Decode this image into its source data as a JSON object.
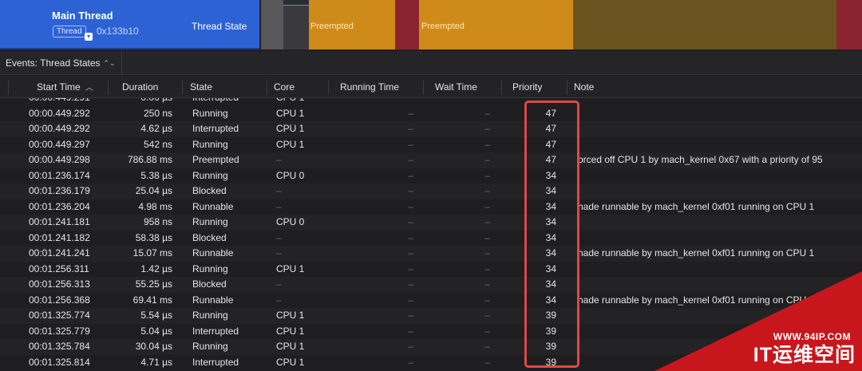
{
  "track": {
    "thread_name": "Main Thread",
    "thread_badge": "Thread",
    "thread_id": "0x133b10",
    "lane_label": "Thread State",
    "segments": [
      {
        "label": "Preempted"
      },
      {
        "label": "Preempted"
      }
    ]
  },
  "events_bar": {
    "selector_label": "Events: Thread States",
    "selector_icon": "chevron-up-down-icon"
  },
  "table": {
    "columns": {
      "start_time": "Start Time",
      "duration": "Duration",
      "state": "State",
      "core": "Core",
      "running_time": "Running Time",
      "wait_time": "Wait Time",
      "priority": "Priority",
      "note": "Note"
    },
    "sort_icon": "sort-ascending-icon",
    "clipped_top_row": {
      "start": "00:00.449.291",
      "duration": "0.00 µs",
      "state": "Interrupted",
      "core": "CPU 1"
    },
    "rows": [
      {
        "start": "00:00.449.292",
        "duration": "250 ns",
        "state": "Running",
        "core": "CPU 1",
        "running": "–",
        "wait": "–",
        "priority": "47",
        "note": ""
      },
      {
        "start": "00:00.449.292",
        "duration": "4.62 µs",
        "state": "Interrupted",
        "core": "CPU 1",
        "running": "–",
        "wait": "–",
        "priority": "47",
        "note": ""
      },
      {
        "start": "00:00.449.297",
        "duration": "542 ns",
        "state": "Running",
        "core": "CPU 1",
        "running": "–",
        "wait": "–",
        "priority": "47",
        "note": ""
      },
      {
        "start": "00:00.449.298",
        "duration": "786.88 ms",
        "state": "Preempted",
        "core": "–",
        "running": "–",
        "wait": "–",
        "priority": "47",
        "note": "orced off CPU 1 by mach_kernel  0x67 with a priority of 95"
      },
      {
        "start": "00:01.236.174",
        "duration": "5.38 µs",
        "state": "Running",
        "core": "CPU 0",
        "running": "–",
        "wait": "–",
        "priority": "34",
        "note": ""
      },
      {
        "start": "00:01.236.179",
        "duration": "25.04 µs",
        "state": "Blocked",
        "core": "–",
        "running": "–",
        "wait": "–",
        "priority": "34",
        "note": ""
      },
      {
        "start": "00:01.236.204",
        "duration": "4.98 ms",
        "state": "Runnable",
        "core": "–",
        "running": "–",
        "wait": "–",
        "priority": "34",
        "note": "nade runnable by mach_kernel  0xf01 running on CPU 1"
      },
      {
        "start": "00:01.241.181",
        "duration": "958 ns",
        "state": "Running",
        "core": "CPU 0",
        "running": "–",
        "wait": "–",
        "priority": "34",
        "note": ""
      },
      {
        "start": "00:01.241.182",
        "duration": "58.38 µs",
        "state": "Blocked",
        "core": "–",
        "running": "–",
        "wait": "–",
        "priority": "34",
        "note": ""
      },
      {
        "start": "00:01.241.241",
        "duration": "15.07 ms",
        "state": "Runnable",
        "core": "–",
        "running": "–",
        "wait": "–",
        "priority": "34",
        "note": "nade runnable by mach_kernel  0xf01 running on CPU 1"
      },
      {
        "start": "00:01.256.311",
        "duration": "1.42 µs",
        "state": "Running",
        "core": "CPU 1",
        "running": "–",
        "wait": "–",
        "priority": "34",
        "note": ""
      },
      {
        "start": "00:01.256.313",
        "duration": "55.25 µs",
        "state": "Blocked",
        "core": "–",
        "running": "–",
        "wait": "–",
        "priority": "34",
        "note": ""
      },
      {
        "start": "00:01.256.368",
        "duration": "69.41 ms",
        "state": "Runnable",
        "core": "–",
        "running": "–",
        "wait": "–",
        "priority": "34",
        "note": "nade runnable by mach_kernel  0xf01 running on CPU 1"
      },
      {
        "start": "00:01.325.774",
        "duration": "5.54 µs",
        "state": "Running",
        "core": "CPU 1",
        "running": "–",
        "wait": "–",
        "priority": "39",
        "note": ""
      },
      {
        "start": "00:01.325.779",
        "duration": "5.04 µs",
        "state": "Interrupted",
        "core": "CPU 1",
        "running": "–",
        "wait": "–",
        "priority": "39",
        "note": ""
      },
      {
        "start": "00:01.325.784",
        "duration": "30.04 µs",
        "state": "Running",
        "core": "CPU 1",
        "running": "–",
        "wait": "–",
        "priority": "39",
        "note": ""
      },
      {
        "start": "00:01.325.814",
        "duration": "4.71 µs",
        "state": "Interrupted",
        "core": "CPU 1",
        "running": "–",
        "wait": "–",
        "priority": "39",
        "note": ""
      }
    ]
  },
  "watermark": {
    "url": "WWW.94IP.COM",
    "brand": "IT运维空间"
  },
  "colors": {
    "thread_panel": "#2d62d4",
    "preempted_segment": "#cf8b1a",
    "highlight_box": "#e04848",
    "watermark": "#c8161d"
  }
}
